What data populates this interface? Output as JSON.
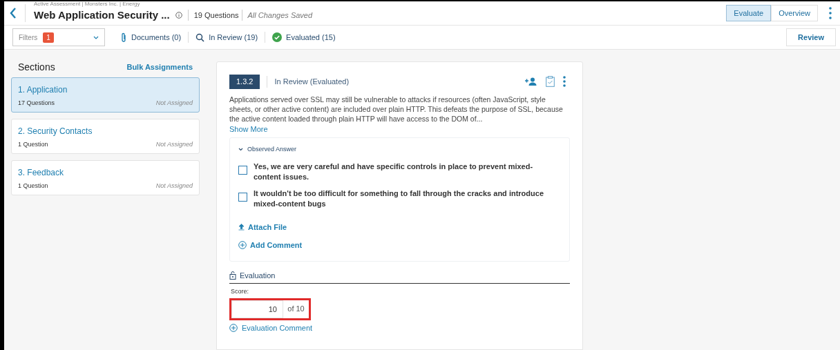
{
  "header": {
    "breadcrumb": "Active Assessment | Monsters Inc. | Energy",
    "title": "Web Application Security ...",
    "question_count": "19 Questions",
    "save_status": "All Changes Saved",
    "view_tabs": [
      {
        "label": "Evaluate",
        "selected": true
      },
      {
        "label": "Overview",
        "selected": false
      }
    ]
  },
  "toolbar": {
    "filters_label": "Filters",
    "filters_count": "1",
    "links": [
      {
        "kind": "documents",
        "label": "Documents (0)"
      },
      {
        "kind": "review",
        "label": "In Review (19)"
      },
      {
        "kind": "evaluated",
        "label": "Evaluated (15)"
      }
    ],
    "review_button": "Review"
  },
  "sidebar": {
    "title": "Sections",
    "action": "Bulk Assignments",
    "items": [
      {
        "title": "1. Application",
        "count": "17 Questions",
        "assignee": "Not Assigned",
        "selected": true
      },
      {
        "title": "2. Security Contacts",
        "count": "1 Question",
        "assignee": "Not Assigned",
        "selected": false
      },
      {
        "title": "3. Feedback",
        "count": "1 Question",
        "assignee": "Not Assigned",
        "selected": false
      }
    ]
  },
  "question": {
    "number": "1.3.2",
    "status": "In Review (Evaluated)",
    "text": "Applications served over SSL may still be vulnerable to attacks if resources (often JavaScript, style sheets, or other active content) are included over plain HTTP. This defeats the purpose of SSL, because the active content loaded through plain HTTP will have access to the DOM of...",
    "show_more": "Show More",
    "answer": {
      "title": "Observed Answer",
      "expanded": true,
      "options": [
        {
          "label": "Yes, we are very careful and have specific controls in place to prevent mixed-content issues.",
          "checked": false
        },
        {
          "label": "It wouldn't be too difficult for something to fall through the cracks and introduce mixed-content bugs",
          "checked": false
        }
      ],
      "attach": "Attach File",
      "comment": "Add Comment"
    },
    "evaluation": {
      "title": "Evaluation",
      "score_label": "Score:",
      "score": "10",
      "score_max": "of 10",
      "comment": "Evaluation Comment"
    }
  }
}
